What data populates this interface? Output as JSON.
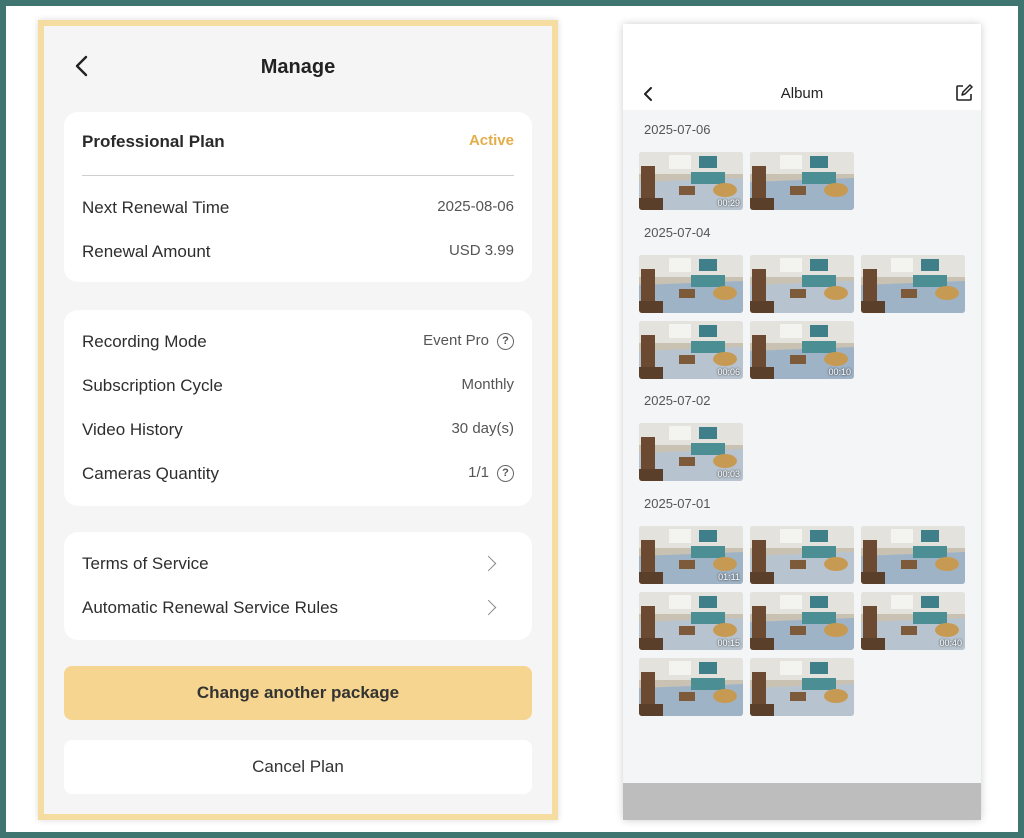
{
  "manage": {
    "title": "Manage",
    "plan": {
      "name": "Professional Plan",
      "status": "Active"
    },
    "renewal": [
      {
        "label": "Next Renewal Time",
        "value": "2025-08-06"
      },
      {
        "label": "Renewal Amount",
        "value": "USD 3.99"
      }
    ],
    "details": [
      {
        "label": "Recording Mode",
        "value": "Event Pro",
        "help": true
      },
      {
        "label": "Subscription Cycle",
        "value": "Monthly",
        "help": false
      },
      {
        "label": "Video History",
        "value": "30 day(s)",
        "help": false
      },
      {
        "label": "Cameras Quantity",
        "value": "1/1",
        "help": true
      }
    ],
    "links": [
      {
        "label": "Terms of Service"
      },
      {
        "label": "Automatic Renewal Service Rules"
      }
    ],
    "change_button": "Change another package",
    "cancel_button": "Cancel Plan",
    "colors": {
      "accent": "#f5d58f",
      "active": "#e3ae4a",
      "frame": "#f5dca0",
      "border": "#3f7570"
    }
  },
  "album": {
    "title": "Album",
    "icons": {
      "back": "back-chevron-icon",
      "edit": "edit-icon"
    },
    "groups": [
      {
        "date": "2025-07-06",
        "thumbs": [
          {
            "duration": "00:29"
          },
          {
            "duration": ""
          }
        ]
      },
      {
        "date": "2025-07-04",
        "thumbs": [
          {
            "duration": ""
          },
          {
            "duration": ""
          },
          {
            "duration": ""
          },
          {
            "duration": "00:06"
          },
          {
            "duration": "00:10"
          }
        ]
      },
      {
        "date": "2025-07-02",
        "thumbs": [
          {
            "duration": "00:03"
          }
        ]
      },
      {
        "date": "2025-07-01",
        "thumbs": [
          {
            "duration": "01:11"
          },
          {
            "duration": ""
          },
          {
            "duration": ""
          },
          {
            "duration": "00:15"
          },
          {
            "duration": ""
          },
          {
            "duration": "00:40"
          },
          {
            "duration": ""
          },
          {
            "duration": ""
          }
        ]
      }
    ]
  }
}
